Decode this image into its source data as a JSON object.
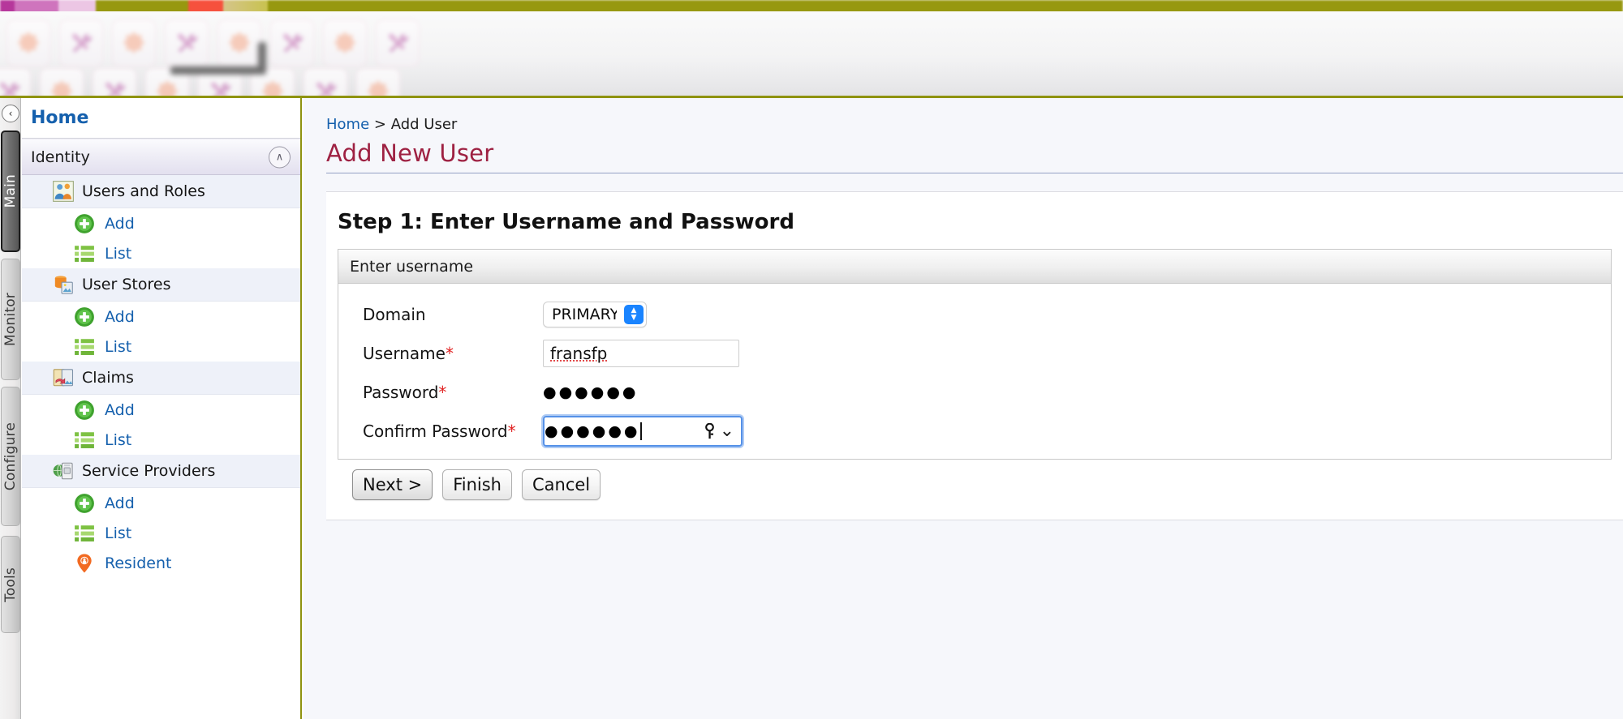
{
  "chrome": {
    "toolbar_icons": [
      "gear-icon",
      "hammer-wrench-icon",
      "gear-icon",
      "hammer-wrench-icon",
      "gear-icon",
      "hammer-wrench-icon",
      "gear-icon",
      "hammer-wrench-icon",
      "hammer-wrench-icon",
      "gear-icon",
      "hammer-wrench-icon",
      "gear-icon",
      "hammer-wrench-icon",
      "gear-icon",
      "hammer-wrench-icon",
      "gear-icon"
    ]
  },
  "rail": {
    "collapse_label": "‹",
    "tabs": [
      {
        "label": "Main",
        "active": true
      },
      {
        "label": "Monitor",
        "active": false
      },
      {
        "label": "Configure",
        "active": false
      },
      {
        "label": "Tools",
        "active": false
      }
    ]
  },
  "nav": {
    "home_label": "Home",
    "section_label": "Identity",
    "collapse_label": "∧",
    "items": [
      {
        "type": "group",
        "label": "Users and Roles",
        "icon": "users-roles-icon"
      },
      {
        "type": "link",
        "label": "Add",
        "icon": "add-icon"
      },
      {
        "type": "link",
        "label": "List",
        "icon": "list-icon"
      },
      {
        "type": "group",
        "label": "User Stores",
        "icon": "user-stores-icon"
      },
      {
        "type": "link",
        "label": "Add",
        "icon": "add-icon"
      },
      {
        "type": "link",
        "label": "List",
        "icon": "list-icon"
      },
      {
        "type": "group",
        "label": "Claims",
        "icon": "claims-icon"
      },
      {
        "type": "link",
        "label": "Add",
        "icon": "add-icon"
      },
      {
        "type": "link",
        "label": "List",
        "icon": "list-icon"
      },
      {
        "type": "group",
        "label": "Service Providers",
        "icon": "service-providers-icon"
      },
      {
        "type": "link",
        "label": "Add",
        "icon": "add-icon"
      },
      {
        "type": "link",
        "label": "List",
        "icon": "list-icon"
      },
      {
        "type": "link",
        "label": "Resident",
        "icon": "resident-icon"
      }
    ]
  },
  "content": {
    "breadcrumb_home": "Home",
    "breadcrumb_separator": ">",
    "breadcrumb_current": "Add User",
    "page_title": "Add New User",
    "step_heading": "Step 1: Enter Username and Password",
    "form_header": "Enter username",
    "fields": {
      "domain": {
        "label": "Domain",
        "value": "PRIMARY",
        "options": [
          "PRIMARY"
        ]
      },
      "username": {
        "label": "Username",
        "required_marker": "*",
        "value": "fransfp",
        "placeholder": ""
      },
      "password": {
        "label": "Password",
        "required_marker": "*",
        "value": "●●●●●●",
        "placeholder": ""
      },
      "confirm_password": {
        "label": "Confirm Password",
        "required_marker": "*",
        "value": "●●●●●●",
        "placeholder": "",
        "focused": true,
        "affordance_icon": "key-icon",
        "affordance_chevron": "⌄"
      }
    },
    "buttons": {
      "next": "Next >",
      "finish": "Finish",
      "cancel": "Cancel"
    }
  },
  "colors": {
    "accent_olive": "#8f9310",
    "title_maroon": "#9e2142",
    "link_blue": "#1560ad",
    "required_red": "#e02020",
    "focus_blue": "#5591e8",
    "stepper_blue": "#1a84ff"
  }
}
